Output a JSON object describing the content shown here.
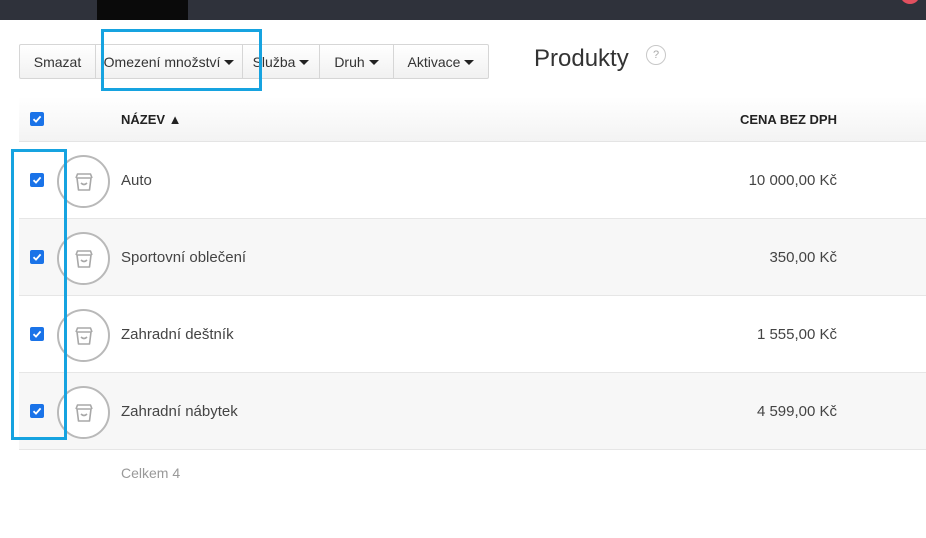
{
  "toolbar": {
    "delete_label": "Smazat",
    "quantity_limit_label": "Omezení množství",
    "service_label": "Služba",
    "type_label": "Druh",
    "activation_label": "Aktivace"
  },
  "page": {
    "title": "Produkty",
    "help_glyph": "?"
  },
  "table": {
    "columns": {
      "name": "NÁZEV ▲",
      "price": "CENA BEZ DPH"
    },
    "rows": [
      {
        "name": "Auto",
        "price": "10 000,00 Kč",
        "checked": true
      },
      {
        "name": "Sportovní oblečení",
        "price": "350,00 Kč",
        "checked": true
      },
      {
        "name": "Zahradní deštník",
        "price": "1 555,00 Kč",
        "checked": true
      },
      {
        "name": "Zahradní nábytek",
        "price": "4 599,00 Kč",
        "checked": true
      }
    ],
    "select_all_checked": true
  },
  "footer": {
    "total": "Celkem 4"
  },
  "colors": {
    "accent": "#1a73e8",
    "highlight": "#16a3e0",
    "topbar": "#2f323b"
  }
}
